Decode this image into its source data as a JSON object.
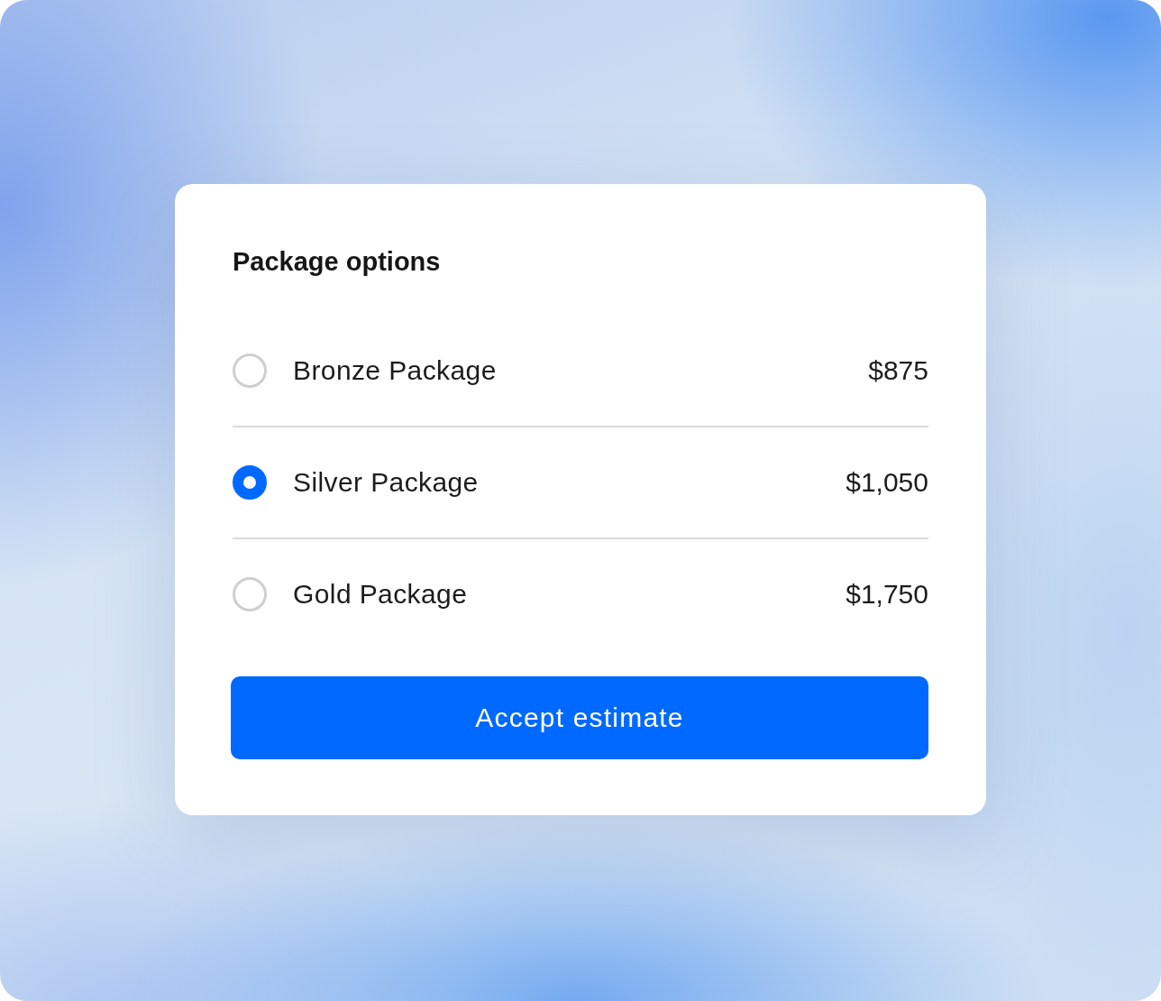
{
  "title": "Package options",
  "packages": [
    {
      "name": "Bronze Package",
      "price": "$875",
      "selected": false
    },
    {
      "name": "Silver Package",
      "price": "$1,050",
      "selected": true
    },
    {
      "name": "Gold Package",
      "price": "$1,750",
      "selected": false
    }
  ],
  "button": {
    "label": "Accept estimate"
  }
}
